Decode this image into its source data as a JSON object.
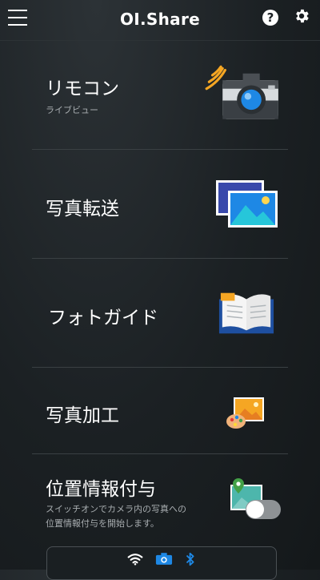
{
  "app": {
    "title": "OI.Share"
  },
  "header": {
    "help_glyph": "?"
  },
  "menu": [
    {
      "label": "リモコン",
      "sublabel": "ライブビュー",
      "icon": "camera-icon"
    },
    {
      "label": "写真転送",
      "icon": "photo-transfer-icon"
    },
    {
      "label": "フォトガイド",
      "icon": "book-icon"
    },
    {
      "label": "写真加工",
      "icon": "photo-edit-icon"
    },
    {
      "label": "位置情報付与",
      "sublabel_line1": "スイッチオンでカメラ内の写真への",
      "sublabel_line2": "位置情報付与を開始します。",
      "icon": "map-pin-icon",
      "toggle_on": false
    }
  ],
  "status": {
    "icons": [
      "wifi-icon",
      "camera-icon",
      "bluetooth-icon"
    ]
  },
  "colors": {
    "background": "#1b2023",
    "accent_blue": "#1e88e5",
    "accent_orange": "#f5a623"
  }
}
